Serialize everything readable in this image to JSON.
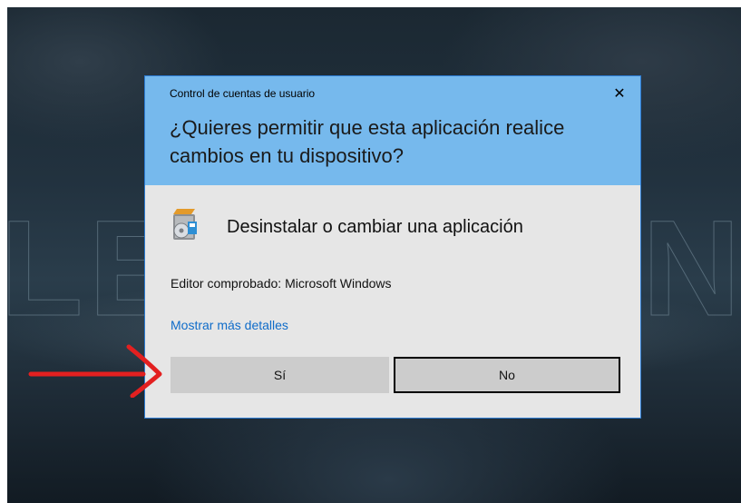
{
  "dialog": {
    "title": "Control de cuentas de usuario",
    "close_symbol": "✕",
    "question": "¿Quieres permitir que esta aplicación realice cambios en tu dispositivo?",
    "app_name": "Desinstalar o cambiar una aplicación",
    "app_icon": "programs-installer-icon",
    "publisher": "Editor comprobado: Microsoft Windows",
    "details_link": "Mostrar más detalles",
    "yes_label": "Sí",
    "no_label": "No"
  },
  "colors": {
    "header": "#76b9ed",
    "body": "#e6e6e6",
    "link": "#0f6cc9",
    "annotation_arrow": "#e32020"
  }
}
